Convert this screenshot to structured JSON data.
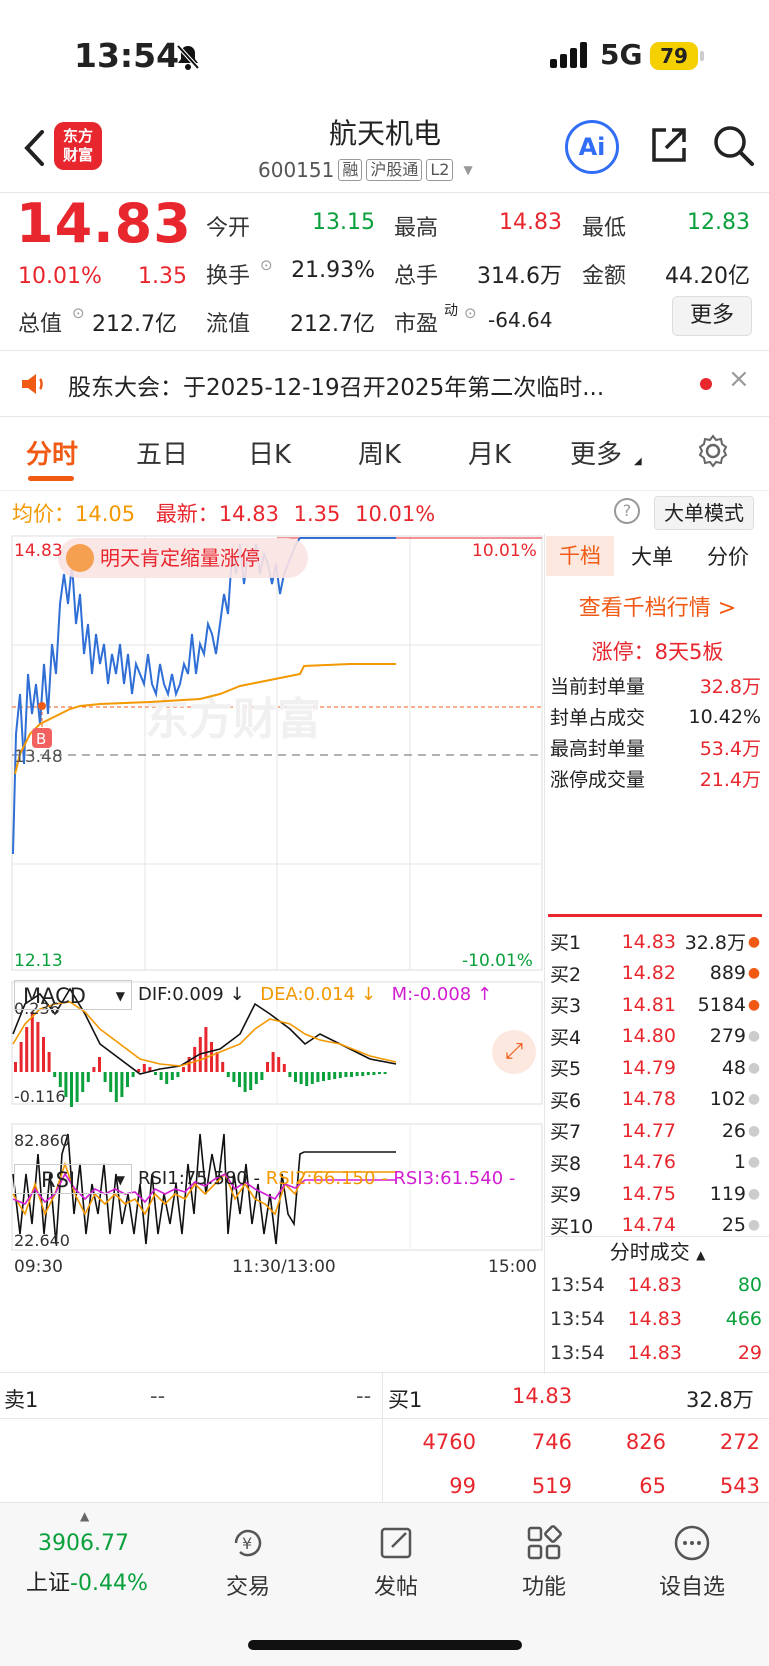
{
  "status": {
    "time": "13:54",
    "network": "5G",
    "battery": "79"
  },
  "header": {
    "logo": "东方\n财富",
    "name": "航天机电",
    "code": "600151",
    "tags": [
      "融",
      "沪股通",
      "L2"
    ],
    "ai": "Ai"
  },
  "quote": {
    "price": "14.83",
    "pct": "10.01%",
    "change": "1.35",
    "open_label": "今开",
    "open": "13.15",
    "high_label": "最高",
    "high": "14.83",
    "low_label": "最低",
    "low": "12.83",
    "turnover_label": "换手",
    "turnover": "21.93%",
    "volume_label": "总手",
    "volume": "314.6万",
    "amount_label": "金额",
    "amount": "44.20亿",
    "mcap_label": "总值",
    "mcap": "212.7亿",
    "float_label": "流值",
    "float": "212.7亿",
    "pe_label": "市盈",
    "pe_sup": "动",
    "pe": "-64.64",
    "more": "更多"
  },
  "notice": {
    "text": "股东大会：于2025-12-19召开2025年第二次临时..."
  },
  "tabs": [
    "分时",
    "五日",
    "日K",
    "周K",
    "月K",
    "更多"
  ],
  "chart_header": {
    "avg_label": "均价：",
    "avg": "14.05",
    "latest_label": "最新：",
    "latest": "14.83",
    "chg": "1.35",
    "pct": "10.01%",
    "mode": "大单模式"
  },
  "chart": {
    "ymax_label": "14.83",
    "ymin_label": "12.13",
    "mid_label": "13.48",
    "pct_top": "10.01%",
    "pct_bottom": "-10.01%",
    "bubble": "明天肯定缩量涨停",
    "buy_marker": "B",
    "watermark": "东方财富",
    "x_labels": [
      "09:30",
      "11:30/13:00",
      "15:00"
    ]
  },
  "macd": {
    "name": "MACD",
    "dif": "DIF:0.009 ↓",
    "dea": "DEA:0.014 ↓",
    "m": "M:-0.008 ↑",
    "top": "0.236",
    "bottom": "-0.116"
  },
  "rsi": {
    "name": "RSI",
    "rsi1": "RSI1:75.580 -",
    "rsi2": "RSI2:66.150 -",
    "rsi3": "RSI3:61.540 -",
    "top": "82.860",
    "bottom": "22.640"
  },
  "right_panel": {
    "tabs": [
      "千档",
      "大单",
      "分价"
    ],
    "link": "查看千档行情 >",
    "limit": "涨停：8天5板",
    "rows": [
      {
        "label": "当前封单量",
        "value": "32.8万"
      },
      {
        "label": "封单占成交",
        "value": "10.42%"
      },
      {
        "label": "最高封单量",
        "value": "53.4万"
      },
      {
        "label": "涨停成交量",
        "value": "21.4万"
      }
    ],
    "orderbook": [
      {
        "label": "买1",
        "price": "14.83",
        "vol": "32.8万"
      },
      {
        "label": "买2",
        "price": "14.82",
        "vol": "889"
      },
      {
        "label": "买3",
        "price": "14.81",
        "vol": "5184"
      },
      {
        "label": "买4",
        "price": "14.80",
        "vol": "279"
      },
      {
        "label": "买5",
        "price": "14.79",
        "vol": "48"
      },
      {
        "label": "买6",
        "price": "14.78",
        "vol": "102"
      },
      {
        "label": "买7",
        "price": "14.77",
        "vol": "26"
      },
      {
        "label": "买8",
        "price": "14.76",
        "vol": "1"
      },
      {
        "label": "买9",
        "price": "14.75",
        "vol": "119"
      },
      {
        "label": "买10",
        "price": "14.74",
        "vol": "25"
      }
    ],
    "trades_title": "分时成交",
    "trades": [
      {
        "time": "13:54",
        "price": "14.83",
        "vol": "80"
      },
      {
        "time": "13:54",
        "price": "14.83",
        "vol": "466"
      },
      {
        "time": "13:54",
        "price": "14.83",
        "vol": "29"
      }
    ]
  },
  "bottom_quote": {
    "sell_label": "卖1",
    "sell_price": "--",
    "sell_vol": "--",
    "buy_label": "买1",
    "buy_price": "14.83",
    "buy_vol": "32.8万",
    "row1": [
      "4760",
      "746",
      "826",
      "272"
    ],
    "row2": [
      "99",
      "519",
      "65",
      "543"
    ]
  },
  "bottom_nav": {
    "index_value": "3906.77",
    "index_name": "上证",
    "index_pct": "-0.44%",
    "items": [
      "交易",
      "发帖",
      "功能",
      "设自选"
    ]
  }
}
